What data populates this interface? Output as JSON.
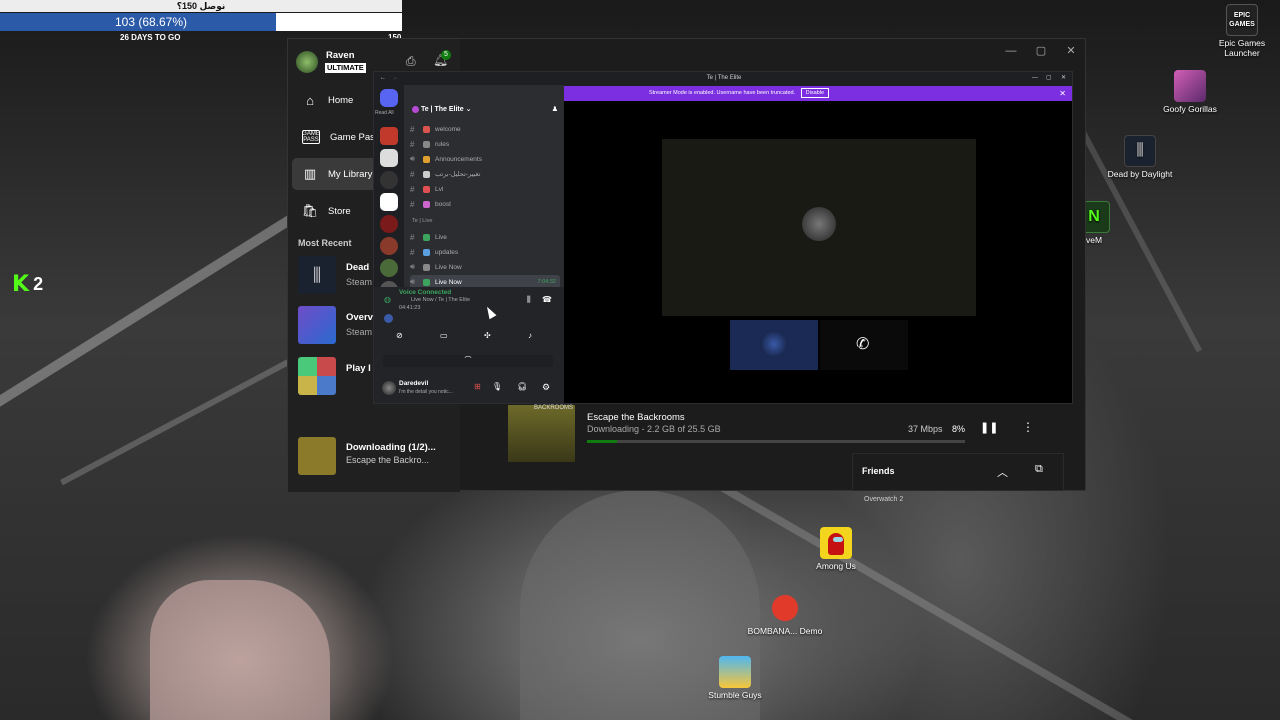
{
  "goal_widget": {
    "title": "نوصل 150؟",
    "progress_text": "103 (68.67%)",
    "progress_fraction": 0.6867,
    "days_text": "26 DAYS TO GO",
    "goal_value": "150"
  },
  "kick_badge": {
    "letter": "K",
    "number": "2"
  },
  "desktop_icons": [
    {
      "label": "Epic Games Launcher",
      "logo_text": "EPIC GAMES"
    },
    {
      "label": "Goofy Gorillas"
    },
    {
      "label": "Dead by Daylight"
    },
    {
      "label": "veM"
    },
    {
      "label": "Among Us"
    },
    {
      "label": "BOMBANA... Demo"
    },
    {
      "label": "Stumble Guys"
    }
  ],
  "xbox": {
    "user_name": "Raven",
    "tier": "ULTIMATE",
    "notification_count": "5",
    "nav": [
      {
        "label": "Home",
        "icon": "home-icon"
      },
      {
        "label": "Game Pass",
        "icon": "gamepass-icon"
      },
      {
        "label": "My Library",
        "icon": "library-icon"
      },
      {
        "label": "Store",
        "icon": "store-icon"
      }
    ],
    "most_recent_heading": "Most Recent",
    "recent": [
      {
        "title": "Dead",
        "sub": "Steam"
      },
      {
        "title": "Overv",
        "sub": "Steam"
      },
      {
        "title": "Play I",
        "sub": ""
      }
    ],
    "downloading": {
      "title": "Downloading (1/2)...",
      "sub": "Escape the Backro..."
    },
    "download_item": {
      "title": "Escape the Backrooms",
      "status": "Downloading - 2.2 GB of 25.5 GB",
      "speed": "37 Mbps",
      "percent": "8%",
      "progress_fraction": 0.08,
      "thumb_text": "BACKROOMS"
    },
    "friends_label": "Friends",
    "friends_overflow_text": "Overwatch 2"
  },
  "discord": {
    "title": "Te | The Elite",
    "read_all": "Read All",
    "banner_text": "Streamer Mode is enabled. Username have been truncated.",
    "banner_button": "Disable",
    "server_name": "Te | The Elite",
    "channels": [
      {
        "name": "welcome",
        "type": "text",
        "emoji_color": "#d9534f"
      },
      {
        "name": "rules",
        "type": "text",
        "emoji_color": "#888888"
      },
      {
        "name": "Announcements",
        "type": "voice",
        "emoji_color": "#e0a030"
      },
      {
        "name": "تغيير-تحليل-برتب",
        "type": "text",
        "emoji_color": "#cccccc"
      },
      {
        "name": "Lvl",
        "type": "text",
        "emoji_color": "#e05050"
      },
      {
        "name": "boost",
        "type": "text",
        "emoji_color": "#cc66cc"
      }
    ],
    "category": "Te | Live",
    "live_channels": [
      {
        "name": "Live",
        "type": "text",
        "emoji_color": "#3ba55d"
      },
      {
        "name": "updates",
        "type": "text",
        "emoji_color": "#5aa0e0"
      },
      {
        "name": "Live Now",
        "type": "voice",
        "emoji_color": "#888888"
      },
      {
        "name": "Live Now",
        "type": "voice",
        "emoji_color": "#3ba55d",
        "time": "7:04:32",
        "selected": true
      }
    ],
    "voice": {
      "status": "Voice Connected",
      "channel": "Live Now / Te | The Elite",
      "elapsed": "04:41:23"
    },
    "user": {
      "name": "Daredevil",
      "status": "I'm the detail you notic..."
    }
  }
}
